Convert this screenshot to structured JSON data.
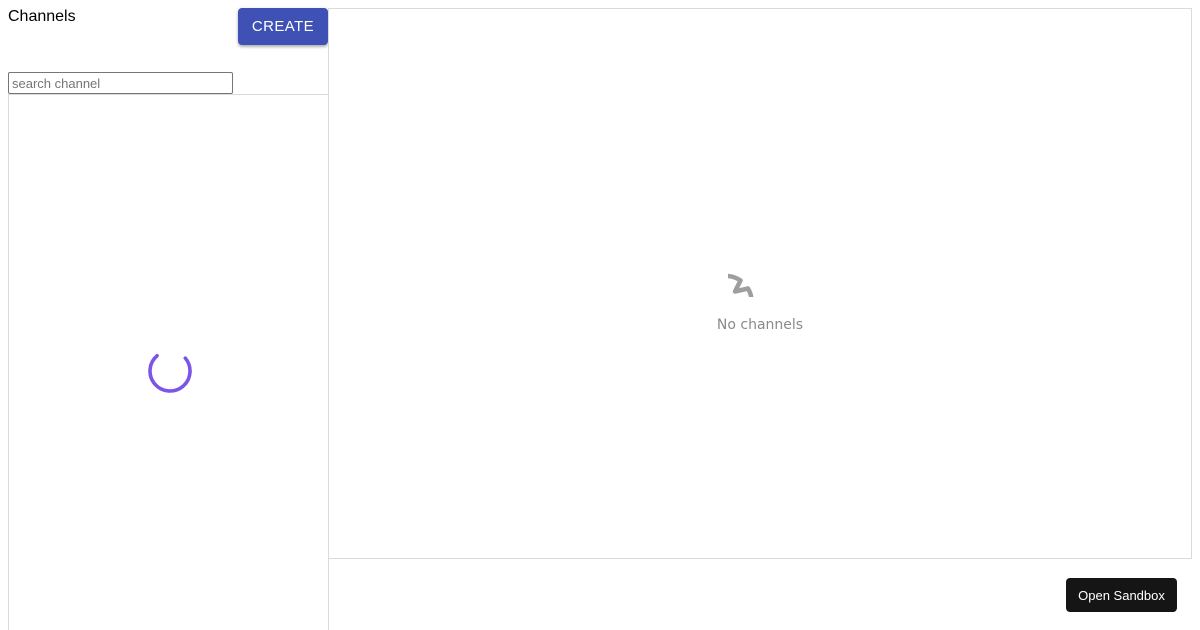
{
  "sidebar": {
    "title": "Channels",
    "create_label": "CREATE",
    "search_placeholder": "search channel",
    "search_value": "",
    "loading_icon": "spinner-icon"
  },
  "main": {
    "empty_icon": "chat-bubble-icon",
    "empty_text": "No channels"
  },
  "footer": {
    "sandbox_label": "Open Sandbox"
  },
  "colors": {
    "create_button": "#3f51b5",
    "spinner": "#7b55e8",
    "empty_icon": "#9e9e9e",
    "sandbox_button": "#151515"
  }
}
